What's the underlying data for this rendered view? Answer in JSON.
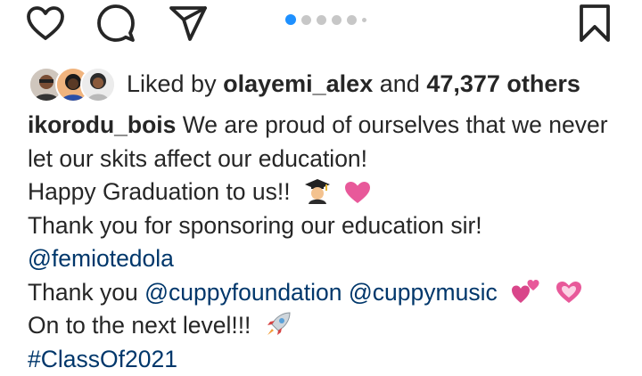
{
  "actions": {
    "like_icon": "heart-outline-icon",
    "comment_icon": "comment-bubble-icon",
    "share_icon": "paper-plane-icon",
    "bookmark_icon": "bookmark-outline-icon"
  },
  "carousel": {
    "total_dots": 6,
    "active_index": 0,
    "accent_color": "#1e90ff"
  },
  "likes": {
    "prefix": "Liked by",
    "user": "olayemi_alex",
    "middle": "and",
    "count": "47,377 others"
  },
  "caption": {
    "username": "ikorodu_bois",
    "line1": "We are proud of ourselves that we never",
    "line2": "let our skits affect our education!",
    "line3": "Happy Graduation to us!!",
    "line4": "Thank you for sponsoring our education sir!",
    "mention1": "@femiotedola",
    "line6_prefix": "Thank you",
    "mention2": "@cuppyfoundation",
    "mention3": "@cuppymusic",
    "line7": "On to the next level!!!",
    "hashtag": "#ClassOf2021"
  },
  "colors": {
    "link": "#00376b",
    "text": "#262626",
    "heart": "#e8599a"
  }
}
